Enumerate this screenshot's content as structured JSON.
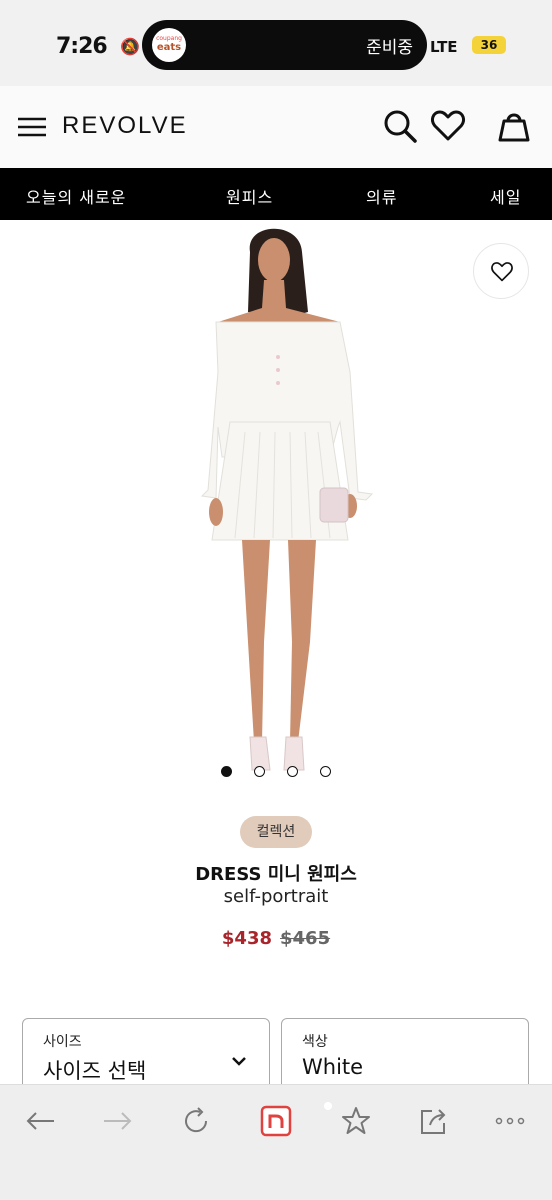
{
  "status_bar": {
    "time": "7:26",
    "app_badge_top": "coupang",
    "app_badge_bottom": "eats",
    "activity_text": "준비중",
    "network": "LTE",
    "battery": "36"
  },
  "header": {
    "logo": "REVOLVE"
  },
  "nav": {
    "items": [
      "오늘의 새로운",
      "원피스",
      "의류",
      "세일"
    ]
  },
  "product": {
    "badge": "컬렉션",
    "title": "DRESS 미니 원피스",
    "brand": "self-portrait",
    "price_sale": "$438",
    "price_original": "$465",
    "image_count": 4,
    "active_image": 1
  },
  "options": {
    "size_label": "사이즈",
    "size_value": "사이즈 선택",
    "color_label": "색상",
    "color_value": "White"
  },
  "colors": {
    "sale": "#a8252b",
    "nav_bg": "#000000",
    "badge_bg": "#e1cbbb",
    "toolbar_accent": "#e0433f"
  },
  "icons": {
    "menu": "menu-icon",
    "search": "search-icon",
    "wishlist": "heart-icon",
    "bag": "bag-icon",
    "back": "arrow-left-icon",
    "forward": "arrow-right-icon",
    "reload": "reload-icon",
    "home": "naver-icon",
    "bookmark": "star-icon",
    "share": "share-icon",
    "more": "more-icon"
  }
}
